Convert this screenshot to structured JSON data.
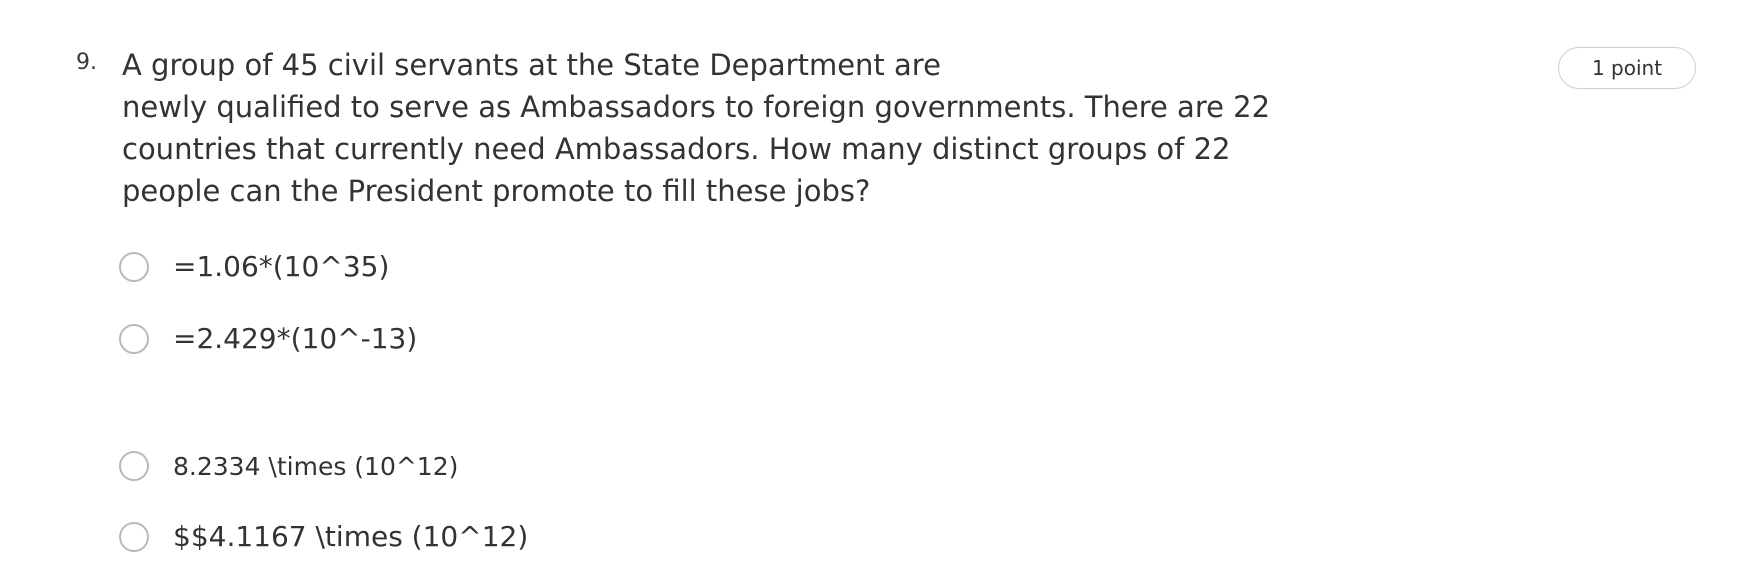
{
  "question": {
    "number": "9.",
    "text_lines": [
      "A group of 45 civil servants at the State Department are",
      "newly qualified to serve as Ambassadors to foreign governments. There are 22",
      "countries that currently need Ambassadors. How many distinct groups of 22",
      "people can the President promote to fill these jobs?"
    ],
    "points": "1 point",
    "options": [
      {
        "label": "=1.06*(10^35)",
        "selected": false
      },
      {
        "label": "=2.429*(10^-13)",
        "selected": false
      },
      {
        "label": "8.2334 \\times (10^12)",
        "selected": false
      },
      {
        "label": "$$4.1167 \\times (10^12)",
        "selected": false
      }
    ]
  },
  "colors": {
    "text": "#333333",
    "radio_border": "#b9b9b9",
    "badge_border": "#cfcfcf",
    "background": "#ffffff"
  }
}
